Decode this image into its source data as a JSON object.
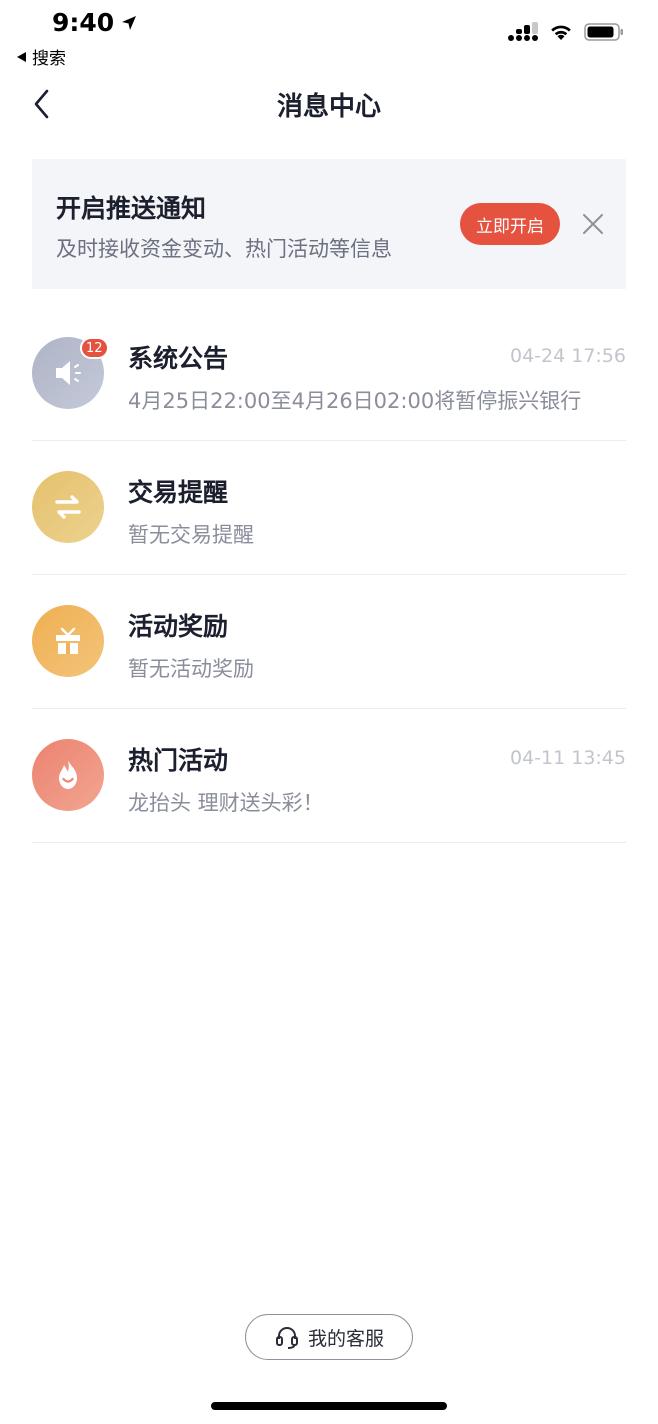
{
  "status_bar": {
    "time": "9:40",
    "back_app": "搜索",
    "icons": [
      "location-arrow-icon",
      "cellular-signal-icon",
      "wifi-icon",
      "battery-icon"
    ]
  },
  "nav": {
    "title": "消息中心",
    "back_icon": "chevron-left-icon"
  },
  "push_banner": {
    "title": "开启推送通知",
    "description": "及时接收资金变动、热门活动等信息",
    "enable_label": "立即开启",
    "close_icon": "close-icon"
  },
  "messages": [
    {
      "title": "系统公告",
      "time": "04-24 17:56",
      "preview": "4月25日22:00至4月26日02:00将暂停振兴银行",
      "badge": "12",
      "icon": "megaphone-icon",
      "color_start": "#aeb3c6",
      "color_end": "#c5cad9"
    },
    {
      "title": "交易提醒",
      "time": "",
      "preview": "暂无交易提醒",
      "badge": "",
      "icon": "exchange-arrows-icon",
      "color_start": "#e4c16c",
      "color_end": "#edd28f"
    },
    {
      "title": "活动奖励",
      "time": "",
      "preview": "暂无活动奖励",
      "badge": "",
      "icon": "gift-icon",
      "color_start": "#eeaf52",
      "color_end": "#f4c47a"
    },
    {
      "title": "热门活动",
      "time": "04-11 13:45",
      "preview": "龙抬头 理财送头彩！",
      "badge": "",
      "icon": "flame-icon",
      "color_start": "#ec8270",
      "color_end": "#f2a592"
    }
  ],
  "service": {
    "label": "我的客服",
    "icon": "headset-icon"
  },
  "colors": {
    "accent": "#e5523f",
    "banner_bg": "#f4f5f8",
    "divider": "#ebecef"
  }
}
